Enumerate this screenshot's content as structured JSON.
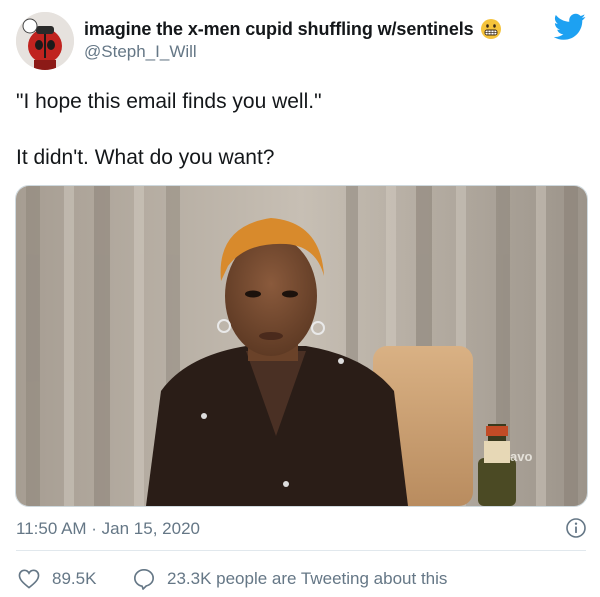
{
  "tweet": {
    "author": {
      "display_name": "imagine the x-men cupid shuffling w/sentinels",
      "handle": "@Steph_I_Will",
      "avatar_icon": "deadpool-avatar",
      "name_emoji_icon": "grimacing-face-emoji"
    },
    "platform_icon": "twitter-bird-icon",
    "text_line1": "\"I hope this email finds you well.\"",
    "text_line2": "It didn't. What do you want?",
    "media": {
      "overlay_text": "avo"
    },
    "timestamp": "11:50 AM · Jan 15, 2020",
    "likes": "89.5K",
    "conversation": "23.3K people are Tweeting about this"
  },
  "colors": {
    "text_primary": "#14171a",
    "text_secondary": "#657786",
    "twitter_blue": "#1da1f2",
    "divider": "#e1e8ed"
  }
}
